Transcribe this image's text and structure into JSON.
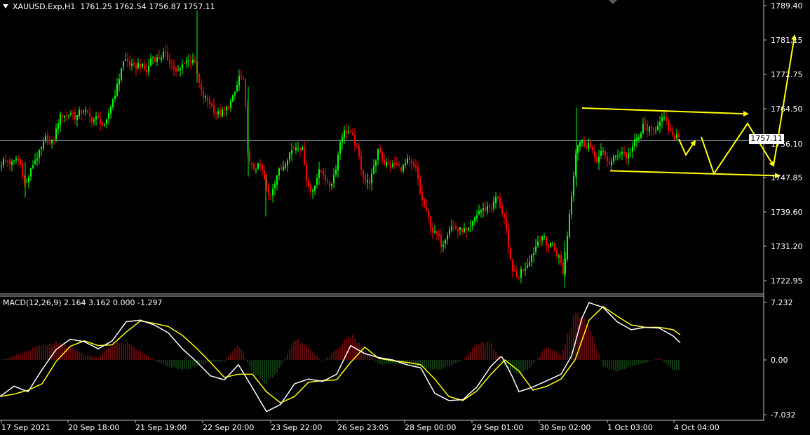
{
  "window": {
    "symbol_line": "XAUUSD.Exp,H1",
    "ohlc": "1761.25 1762.54 1756.87 1757.11",
    "current_price": "1757.11"
  },
  "macd": {
    "label": "MACD(12,26,9)",
    "values": "2.164 3.162 0.000 -1.297",
    "axis_labels": [
      "7.232",
      "0.00",
      "-7.032"
    ]
  },
  "colors": {
    "background": "#000000",
    "bull": "#00ff00",
    "bear": "#ff0000",
    "signal": "#ffff00",
    "macd_line": "#ffffff",
    "hist_pos": "#c01010",
    "hist_neg": "#1d6f1d",
    "annotation": "#ffff00",
    "grid_line": "#c0c0c0"
  },
  "chart_data": {
    "type": "candlestick",
    "title": "XAUUSD.Exp,H1",
    "y_axis_labels": [
      "1789.40",
      "1781.15",
      "1772.75",
      "1764.50",
      "1757.11",
      "1747.85",
      "1739.60",
      "1731.20",
      "1722.95"
    ],
    "ylim": [
      1720.6,
      1790.4
    ],
    "x_axis_labels": [
      "17 Sep 2021",
      "20 Sep 18:00",
      "21 Sep 19:00",
      "22 Sep 20:00",
      "23 Sep 22:00",
      "26 Sep 23:05",
      "28 Sep 00:00",
      "29 Sep 01:00",
      "30 Sep 02:00",
      "1 Oct 03:00",
      "4 Oct 04:00"
    ],
    "close_path": [
      [
        0,
        1751.0
      ],
      [
        6,
        1752.5
      ],
      [
        12,
        1752.0
      ],
      [
        18,
        1751.5
      ],
      [
        24,
        1753.0
      ],
      [
        30,
        1751.0
      ],
      [
        36,
        1746.0
      ],
      [
        42,
        1749.0
      ],
      [
        48,
        1752.0
      ],
      [
        54,
        1753.5
      ],
      [
        60,
        1755.5
      ],
      [
        66,
        1758.0
      ],
      [
        72,
        1756.0
      ],
      [
        78,
        1758.0
      ],
      [
        84,
        1762.5
      ],
      [
        90,
        1763.5
      ],
      [
        96,
        1763.0
      ],
      [
        102,
        1764.0
      ],
      [
        108,
        1762.5
      ],
      [
        114,
        1764.0
      ],
      [
        120,
        1764.5
      ],
      [
        126,
        1763.0
      ],
      [
        132,
        1762.0
      ],
      [
        138,
        1762.5
      ],
      [
        144,
        1761.5
      ],
      [
        150,
        1760.0
      ],
      [
        156,
        1764.5
      ],
      [
        162,
        1767.5
      ],
      [
        168,
        1770.5
      ],
      [
        174,
        1775.5
      ],
      [
        180,
        1776.5
      ],
      [
        186,
        1775.0
      ],
      [
        192,
        1774.5
      ],
      [
        198,
        1775.5
      ],
      [
        204,
        1774.5
      ],
      [
        210,
        1773.5
      ],
      [
        216,
        1777.5
      ],
      [
        222,
        1776.5
      ],
      [
        228,
        1777.0
      ],
      [
        234,
        1778.0
      ],
      [
        240,
        1776.5
      ],
      [
        246,
        1775.0
      ],
      [
        252,
        1773.0
      ],
      [
        258,
        1774.5
      ],
      [
        264,
        1776.5
      ],
      [
        270,
        1776.0
      ],
      [
        276,
        1777.0
      ],
      [
        282,
        1772.0
      ],
      [
        288,
        1768.0
      ],
      [
        294,
        1767.0
      ],
      [
        300,
        1766.0
      ],
      [
        306,
        1764.0
      ],
      [
        312,
        1763.5
      ],
      [
        318,
        1764.0
      ],
      [
        324,
        1765.0
      ],
      [
        330,
        1766.5
      ],
      [
        336,
        1769.0
      ],
      [
        342,
        1773.0
      ],
      [
        348,
        1771.0
      ],
      [
        354,
        1752.0
      ],
      [
        360,
        1750.5
      ],
      [
        366,
        1751.0
      ],
      [
        372,
        1751.0
      ],
      [
        378,
        1747.0
      ],
      [
        384,
        1743.5
      ],
      [
        390,
        1746.5
      ],
      [
        396,
        1749.5
      ],
      [
        402,
        1750.5
      ],
      [
        408,
        1752.5
      ],
      [
        414,
        1754.5
      ],
      [
        420,
        1755.5
      ],
      [
        426,
        1756.0
      ],
      [
        432,
        1754.5
      ],
      [
        438,
        1747.0
      ],
      [
        444,
        1744.5
      ],
      [
        450,
        1747.5
      ],
      [
        456,
        1750.0
      ],
      [
        462,
        1749.0
      ],
      [
        468,
        1746.0
      ],
      [
        474,
        1747.5
      ],
      [
        480,
        1751.5
      ],
      [
        486,
        1758.0
      ],
      [
        492,
        1759.5
      ],
      [
        498,
        1759.0
      ],
      [
        504,
        1757.5
      ],
      [
        510,
        1754.5
      ],
      [
        516,
        1750.0
      ],
      [
        522,
        1747.0
      ],
      [
        528,
        1747.5
      ],
      [
        534,
        1751.0
      ],
      [
        540,
        1756.0
      ],
      [
        546,
        1752.0
      ],
      [
        552,
        1751.5
      ],
      [
        558,
        1751.0
      ],
      [
        564,
        1751.5
      ],
      [
        570,
        1750.5
      ],
      [
        576,
        1751.0
      ],
      [
        582,
        1752.5
      ],
      [
        588,
        1751.0
      ],
      [
        594,
        1750.0
      ],
      [
        600,
        1743.5
      ],
      [
        606,
        1741.0
      ],
      [
        612,
        1738.0
      ],
      [
        618,
        1735.0
      ],
      [
        624,
        1734.5
      ],
      [
        630,
        1732.0
      ],
      [
        636,
        1734.5
      ],
      [
        642,
        1736.5
      ],
      [
        648,
        1736.5
      ],
      [
        654,
        1735.5
      ],
      [
        660,
        1736.0
      ],
      [
        666,
        1735.0
      ],
      [
        672,
        1736.5
      ],
      [
        678,
        1739.0
      ],
      [
        684,
        1740.5
      ],
      [
        690,
        1740.5
      ],
      [
        696,
        1741.5
      ],
      [
        702,
        1741.0
      ],
      [
        708,
        1744.0
      ],
      [
        714,
        1741.0
      ],
      [
        720,
        1738.0
      ],
      [
        726,
        1729.5
      ],
      [
        732,
        1726.0
      ],
      [
        738,
        1724.0
      ],
      [
        744,
        1726.5
      ],
      [
        750,
        1727.0
      ],
      [
        756,
        1729.0
      ],
      [
        762,
        1731.0
      ],
      [
        768,
        1733.5
      ],
      [
        774,
        1734.5
      ],
      [
        780,
        1731.5
      ],
      [
        786,
        1733.0
      ],
      [
        792,
        1730.5
      ],
      [
        798,
        1729.0
      ],
      [
        804,
        1725.0
      ],
      [
        810,
        1736.5
      ],
      [
        816,
        1746.0
      ],
      [
        822,
        1756.0
      ],
      [
        828,
        1757.0
      ],
      [
        834,
        1756.0
      ],
      [
        840,
        1756.5
      ],
      [
        846,
        1753.5
      ],
      [
        852,
        1752.5
      ],
      [
        858,
        1754.5
      ],
      [
        864,
        1753.0
      ],
      [
        870,
        1751.5
      ],
      [
        876,
        1753.0
      ],
      [
        882,
        1754.0
      ],
      [
        888,
        1754.5
      ],
      [
        894,
        1753.0
      ],
      [
        900,
        1755.0
      ],
      [
        906,
        1757.0
      ],
      [
        912,
        1758.0
      ],
      [
        918,
        1761.0
      ],
      [
        924,
        1760.0
      ],
      [
        930,
        1759.0
      ],
      [
        936,
        1760.5
      ],
      [
        942,
        1762.5
      ],
      [
        948,
        1762.0
      ],
      [
        954,
        1759.5
      ],
      [
        960,
        1757.5
      ],
      [
        966,
        1759.0
      ],
      [
        970,
        1757.11
      ]
    ],
    "macd_histogram_path": [
      [
        0,
        0.0
      ],
      [
        20,
        0.5
      ],
      [
        40,
        1.2
      ],
      [
        60,
        1.9
      ],
      [
        80,
        2.2
      ],
      [
        100,
        1.6
      ],
      [
        120,
        0.7
      ],
      [
        140,
        0.3
      ],
      [
        160,
        2.0
      ],
      [
        180,
        2.4
      ],
      [
        200,
        1.1
      ],
      [
        220,
        0.0
      ],
      [
        240,
        -0.9
      ],
      [
        260,
        -1.3
      ],
      [
        280,
        -0.8
      ],
      [
        300,
        -0.3
      ],
      [
        320,
        -0.2
      ],
      [
        340,
        2.0
      ],
      [
        360,
        -1.5
      ],
      [
        380,
        -3.0
      ],
      [
        400,
        -1.0
      ],
      [
        420,
        2.7
      ],
      [
        440,
        1.5
      ],
      [
        460,
        -0.2
      ],
      [
        480,
        1.3
      ],
      [
        500,
        3.2
      ],
      [
        520,
        1.4
      ],
      [
        540,
        -0.6
      ],
      [
        560,
        -0.5
      ],
      [
        580,
        -0.6
      ],
      [
        600,
        -1.0
      ],
      [
        620,
        -1.3
      ],
      [
        640,
        -0.8
      ],
      [
        660,
        0.0
      ],
      [
        680,
        2.0
      ],
      [
        700,
        2.2
      ],
      [
        720,
        -0.9
      ],
      [
        740,
        -2.0
      ],
      [
        760,
        -0.6
      ],
      [
        780,
        1.9
      ],
      [
        800,
        0.6
      ],
      [
        820,
        6.0
      ],
      [
        840,
        4.5
      ],
      [
        860,
        -0.9
      ],
      [
        880,
        -1.4
      ],
      [
        900,
        -0.8
      ],
      [
        920,
        -0.4
      ],
      [
        940,
        0.3
      ],
      [
        960,
        -1.3
      ]
    ],
    "macd_line_path": [
      [
        0,
        -4.6
      ],
      [
        20,
        -3.3
      ],
      [
        40,
        -4.0
      ],
      [
        60,
        -1.2
      ],
      [
        80,
        1.3
      ],
      [
        100,
        2.6
      ],
      [
        120,
        2.3
      ],
      [
        140,
        1.4
      ],
      [
        160,
        2.4
      ],
      [
        180,
        4.8
      ],
      [
        200,
        5.0
      ],
      [
        220,
        4.4
      ],
      [
        240,
        3.4
      ],
      [
        260,
        1.4
      ],
      [
        280,
        -0.2
      ],
      [
        300,
        -2.0
      ],
      [
        320,
        -2.5
      ],
      [
        340,
        -0.6
      ],
      [
        360,
        -3.5
      ],
      [
        380,
        -6.5
      ],
      [
        400,
        -5.6
      ],
      [
        420,
        -3.0
      ],
      [
        440,
        -2.4
      ],
      [
        460,
        -2.7
      ],
      [
        480,
        -1.8
      ],
      [
        500,
        1.8
      ],
      [
        520,
        0.8
      ],
      [
        540,
        0.3
      ],
      [
        560,
        0.0
      ],
      [
        580,
        -0.6
      ],
      [
        600,
        -1.0
      ],
      [
        620,
        -4.2
      ],
      [
        640,
        -5.1
      ],
      [
        660,
        -5.0
      ],
      [
        680,
        -3.4
      ],
      [
        700,
        -0.8
      ],
      [
        715,
        0.5
      ],
      [
        730,
        -2.0
      ],
      [
        740,
        -4.0
      ],
      [
        760,
        -3.4
      ],
      [
        780,
        -2.6
      ],
      [
        800,
        -1.8
      ],
      [
        815,
        0.5
      ],
      [
        830,
        5.3
      ],
      [
        840,
        7.2
      ],
      [
        860,
        6.6
      ],
      [
        880,
        4.8
      ],
      [
        900,
        3.8
      ],
      [
        920,
        4.1
      ],
      [
        940,
        4.0
      ],
      [
        960,
        3.0
      ],
      [
        970,
        2.164
      ]
    ],
    "signal_line_path": [
      [
        0,
        -4.6
      ],
      [
        20,
        -4.3
      ],
      [
        40,
        -3.8
      ],
      [
        60,
        -3.0
      ],
      [
        80,
        -0.2
      ],
      [
        100,
        1.7
      ],
      [
        120,
        2.4
      ],
      [
        140,
        1.8
      ],
      [
        160,
        1.9
      ],
      [
        180,
        3.5
      ],
      [
        200,
        4.9
      ],
      [
        220,
        4.6
      ],
      [
        240,
        4.2
      ],
      [
        260,
        3.1
      ],
      [
        280,
        1.5
      ],
      [
        300,
        -0.3
      ],
      [
        320,
        -2.2
      ],
      [
        340,
        -1.8
      ],
      [
        360,
        -1.8
      ],
      [
        380,
        -4.0
      ],
      [
        400,
        -5.4
      ],
      [
        420,
        -4.6
      ],
      [
        440,
        -2.8
      ],
      [
        460,
        -2.6
      ],
      [
        480,
        -2.5
      ],
      [
        500,
        -0.3
      ],
      [
        520,
        1.6
      ],
      [
        540,
        0.2
      ],
      [
        560,
        -0.1
      ],
      [
        580,
        -0.3
      ],
      [
        600,
        -0.6
      ],
      [
        620,
        -2.4
      ],
      [
        640,
        -4.6
      ],
      [
        660,
        -5.1
      ],
      [
        680,
        -3.9
      ],
      [
        700,
        -1.8
      ],
      [
        720,
        0.0
      ],
      [
        740,
        -1.4
      ],
      [
        760,
        -3.8
      ],
      [
        780,
        -3.3
      ],
      [
        800,
        -2.4
      ],
      [
        820,
        0.0
      ],
      [
        840,
        5.0
      ],
      [
        860,
        6.7
      ],
      [
        880,
        5.5
      ],
      [
        900,
        4.4
      ],
      [
        920,
        4.1
      ],
      [
        940,
        4.1
      ],
      [
        960,
        3.8
      ],
      [
        970,
        3.162
      ]
    ],
    "annotations": [
      {
        "type": "trend_line",
        "points": [
          [
            830,
            1764.9
          ],
          [
            1066,
            1763.5
          ]
        ]
      },
      {
        "type": "trend_line",
        "points": [
          [
            870,
            1749.9
          ],
          [
            1111,
            1748.7
          ]
        ]
      },
      {
        "type": "arrow_path",
        "points": [
          [
            968,
            1757.5
          ],
          [
            978,
            1753.7
          ],
          [
            991,
            1757.0
          ]
        ]
      },
      {
        "type": "arrow_path",
        "points": [
          [
            1000,
            1758.0
          ],
          [
            1018,
            1749.2
          ],
          [
            1066,
            1761.2
          ],
          [
            1103,
            1751.1
          ]
        ]
      },
      {
        "type": "arrow_path",
        "points": [
          [
            1103,
            1751.1
          ],
          [
            1133,
            1782.2
          ]
        ]
      }
    ]
  }
}
